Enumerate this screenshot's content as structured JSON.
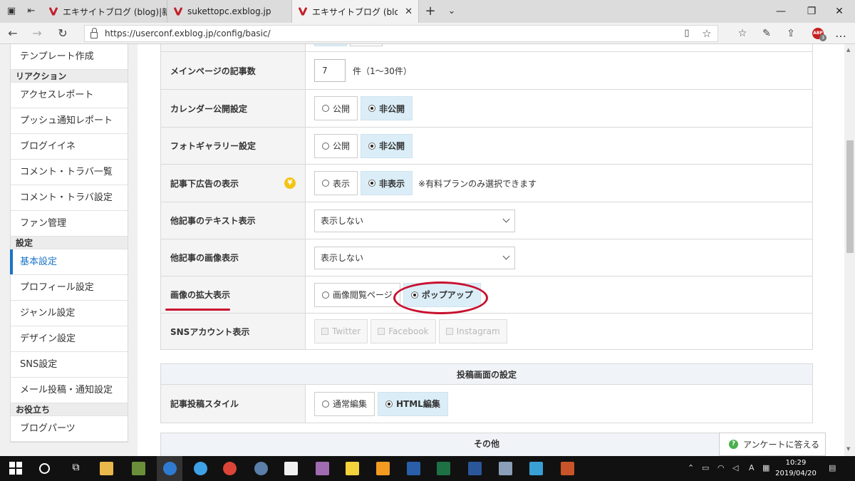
{
  "browser": {
    "tabs": [
      {
        "title": "エキサイトブログ (blog)|新規投"
      },
      {
        "title": "sukettopc.exblog.jp"
      },
      {
        "title": "エキサイトブログ (blog)|基本"
      }
    ],
    "url": "https://userconf.exblog.jp/config/basic/",
    "abp_label": "ABP",
    "abp_count": "3"
  },
  "sidebar": {
    "items": [
      {
        "type": "item",
        "label": "テンプレート作成"
      },
      {
        "type": "head",
        "label": "リアクション"
      },
      {
        "type": "item",
        "label": "アクセスレポート"
      },
      {
        "type": "item",
        "label": "プッシュ通知レポート"
      },
      {
        "type": "item",
        "label": "ブログイイネ"
      },
      {
        "type": "item",
        "label": "コメント・トラバ一覧"
      },
      {
        "type": "item",
        "label": "コメント・トラバ設定"
      },
      {
        "type": "item",
        "label": "ファン管理"
      },
      {
        "type": "head",
        "label": "設定"
      },
      {
        "type": "item",
        "label": "基本設定",
        "active": true
      },
      {
        "type": "item",
        "label": "プロフィール設定"
      },
      {
        "type": "item",
        "label": "ジャンル設定"
      },
      {
        "type": "item",
        "label": "デザイン設定"
      },
      {
        "type": "item",
        "label": "SNS設定"
      },
      {
        "type": "item",
        "label": "メール投稿・通知設定"
      },
      {
        "type": "head",
        "label": "お役立ち"
      },
      {
        "type": "item",
        "label": "ブログパーツ"
      }
    ]
  },
  "settings": {
    "main_page_count": {
      "label": "メインページの記事数",
      "value": "7",
      "suffix": "件（1〜30件）"
    },
    "calendar": {
      "label": "カレンダー公開設定",
      "opt_public": "公開",
      "opt_private": "非公開"
    },
    "photo_gallery": {
      "label": "フォトギャラリー設定",
      "opt_public": "公開",
      "opt_private": "非公開"
    },
    "ad_display": {
      "label": "記事下広告の表示",
      "yen": "¥",
      "opt_show": "表示",
      "opt_hide": "非表示",
      "note": "※有料プランのみ選択できます"
    },
    "other_text": {
      "label": "他記事のテキスト表示",
      "value": "表示しない"
    },
    "other_image": {
      "label": "他記事の画像表示",
      "value": "表示しない"
    },
    "image_zoom": {
      "label": "画像の拡大表示",
      "opt_page": "画像閲覧ページ",
      "opt_popup": "ポップアップ"
    },
    "sns": {
      "label": "SNSアカウント表示",
      "twitter": "Twitter",
      "facebook": "Facebook",
      "instagram": "Instagram"
    }
  },
  "post_section": {
    "title": "投稿画面の設定",
    "style": {
      "label": "記事投稿スタイル",
      "opt_normal": "通常編集",
      "opt_html": "HTML編集"
    }
  },
  "other_section": {
    "title": "その他"
  },
  "survey": {
    "icon": "?",
    "label": "アンケートに答える"
  },
  "taskbar": {
    "time": "10:29",
    "date": "2019/04/20"
  },
  "colors": {
    "accent": "#1a73c9",
    "annotation": "#c8102e",
    "selected": "#dbeef8"
  }
}
